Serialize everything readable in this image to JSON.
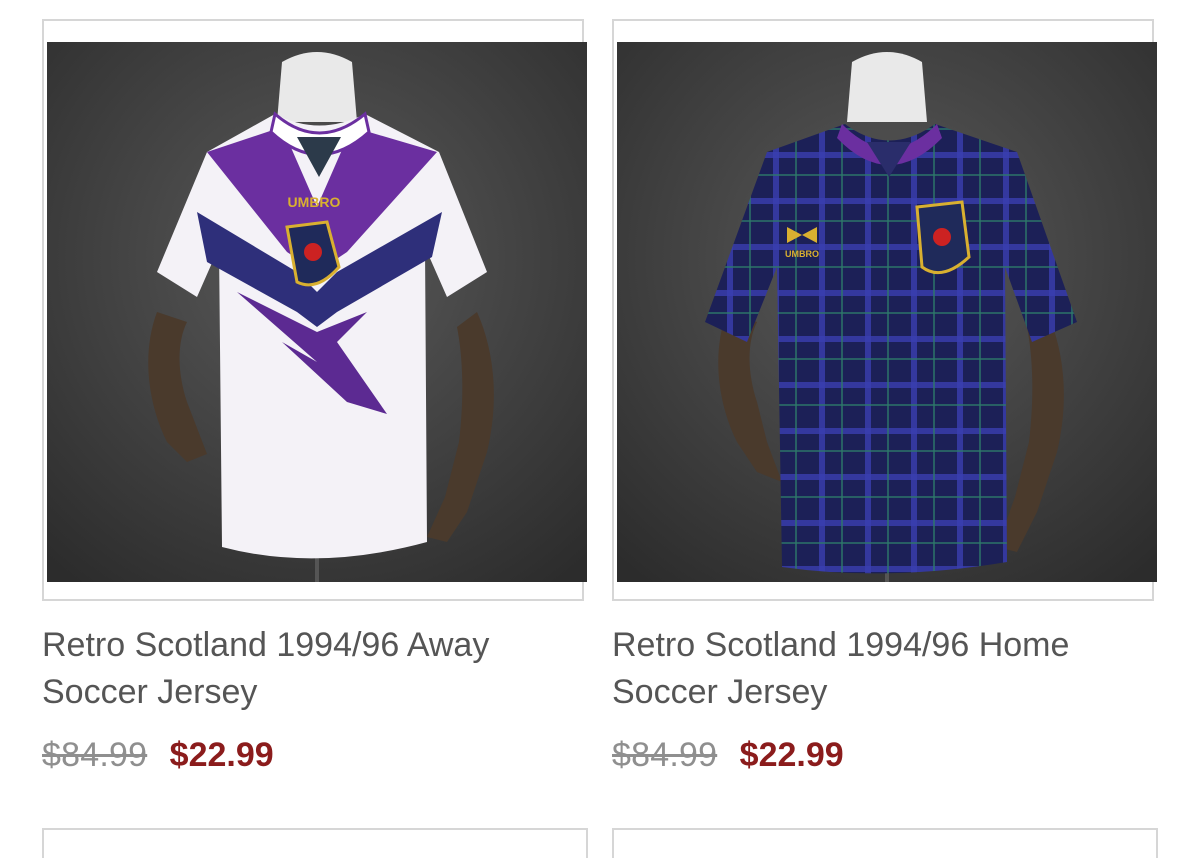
{
  "products": [
    {
      "title_line1": "Retro Scotland 1994/96 Away",
      "title_line2": "Soccer Jersey",
      "original_price": "$84.99",
      "sale_price": "$22.99",
      "image_icon": "away-jersey-photo-icon",
      "brand_text": "UMBRO",
      "colors": {
        "shirt": "#f4f2f7",
        "accent": "#6b2fa0",
        "secondary": "#2e2f7a"
      }
    },
    {
      "title_line1": "Retro Scotland 1994/96 Home",
      "title_line2": "Soccer Jersey",
      "original_price": "$84.99",
      "sale_price": "$22.99",
      "image_icon": "home-jersey-photo-icon",
      "brand_text": "UMBRO",
      "colors": {
        "shirt": "#1c2057",
        "accent": "#6b2fa0",
        "secondary": "#3a3fb0"
      }
    }
  ],
  "theme": {
    "sale_price_color": "#8b1c1c",
    "old_price_color": "#8f8f8f",
    "title_color": "#555555"
  }
}
